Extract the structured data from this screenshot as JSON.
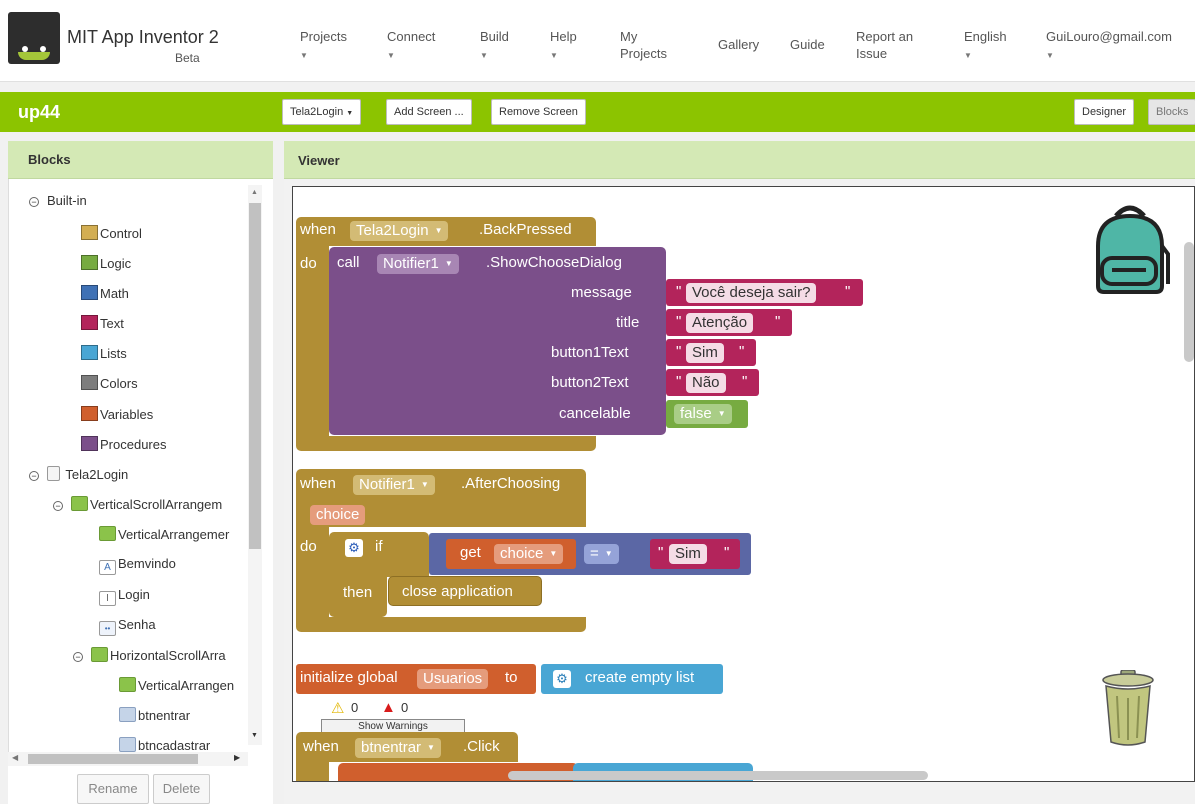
{
  "header": {
    "app_title": "MIT App Inventor 2",
    "app_subtitle": "Beta",
    "menus": [
      {
        "label": "Projects",
        "dropdown": true
      },
      {
        "label": "Connect",
        "dropdown": true
      },
      {
        "label": "Build",
        "dropdown": true
      },
      {
        "label": "Help",
        "dropdown": true
      },
      {
        "label": "My Projects",
        "dropdown": false
      },
      {
        "label": "Gallery",
        "dropdown": false
      },
      {
        "label": "Guide",
        "dropdown": false
      },
      {
        "label": "Report an Issue",
        "dropdown": false
      },
      {
        "label": "English",
        "dropdown": true
      },
      {
        "label": "GuiLouro@gmail.com",
        "dropdown": true
      }
    ]
  },
  "project_bar": {
    "project_name": "up44",
    "screen_select": "Tela2Login",
    "add_screen": "Add Screen ...",
    "remove_screen": "Remove Screen",
    "designer": "Designer",
    "blocks": "Blocks"
  },
  "blocks_panel": {
    "title": "Blocks",
    "tree": {
      "builtin_label": "Built-in",
      "builtin": [
        {
          "label": "Control",
          "color": "#d3ae52"
        },
        {
          "label": "Logic",
          "color": "#77ab41"
        },
        {
          "label": "Math",
          "color": "#3f71b5"
        },
        {
          "label": "Text",
          "color": "#b3245b"
        },
        {
          "label": "Lists",
          "color": "#49a6d4"
        },
        {
          "label": "Colors",
          "color": "#7d7d7d"
        },
        {
          "label": "Variables",
          "color": "#d05f2d"
        },
        {
          "label": "Procedures",
          "color": "#7b4f8a"
        }
      ],
      "components": [
        {
          "label": "Tela2Login",
          "icon": "screen-icon"
        },
        {
          "label": "VerticalScrollArrangem",
          "icon": "vertical-arrangement-icon"
        },
        {
          "label": "VerticalArrangemer",
          "icon": "vertical-arrangement-icon"
        },
        {
          "label": "Bemvindo",
          "icon": "label-icon"
        },
        {
          "label": "Login",
          "icon": "textbox-icon"
        },
        {
          "label": "Senha",
          "icon": "password-icon"
        },
        {
          "label": "HorizontalScrollArra",
          "icon": "horizontal-arrangement-icon"
        },
        {
          "label": "VerticalArrangen",
          "icon": "vertical-arrangement-icon"
        },
        {
          "label": "btnentrar",
          "icon": "button-icon"
        },
        {
          "label": "btncadastrar",
          "icon": "button-icon"
        }
      ]
    },
    "rename": "Rename",
    "delete": "Delete"
  },
  "viewer": {
    "title": "Viewer",
    "block1": {
      "when": "when",
      "component": "Tela2Login",
      "event": ".BackPressed",
      "do": "do",
      "call": "call",
      "notifier": "Notifier1",
      "method": ".ShowChooseDialog",
      "params": [
        {
          "name": "message",
          "value": "Você deseja sair?",
          "type": "text"
        },
        {
          "name": "title",
          "value": "Atenção",
          "type": "text"
        },
        {
          "name": "button1Text",
          "value": "Sim",
          "type": "text"
        },
        {
          "name": "button2Text",
          "value": "Não",
          "type": "text"
        },
        {
          "name": "cancelable",
          "value": "false",
          "type": "logic"
        }
      ]
    },
    "block2": {
      "when": "when",
      "component": "Notifier1",
      "event": ".AfterChoosing",
      "param": "choice",
      "do": "do",
      "if": "if",
      "get": "get",
      "get_var": "choice",
      "op": "=",
      "compare_value": "Sim",
      "then": "then",
      "action": "close application"
    },
    "block3": {
      "label": "initialize global",
      "var_name": "Usuarios",
      "to": "to",
      "value": "create empty list"
    },
    "warnings": {
      "warning_count": "0",
      "error_count": "0",
      "button": "Show Warnings"
    },
    "block4": {
      "when": "when",
      "component": "btnentrar",
      "event": ".Click"
    },
    "quote": "\""
  }
}
